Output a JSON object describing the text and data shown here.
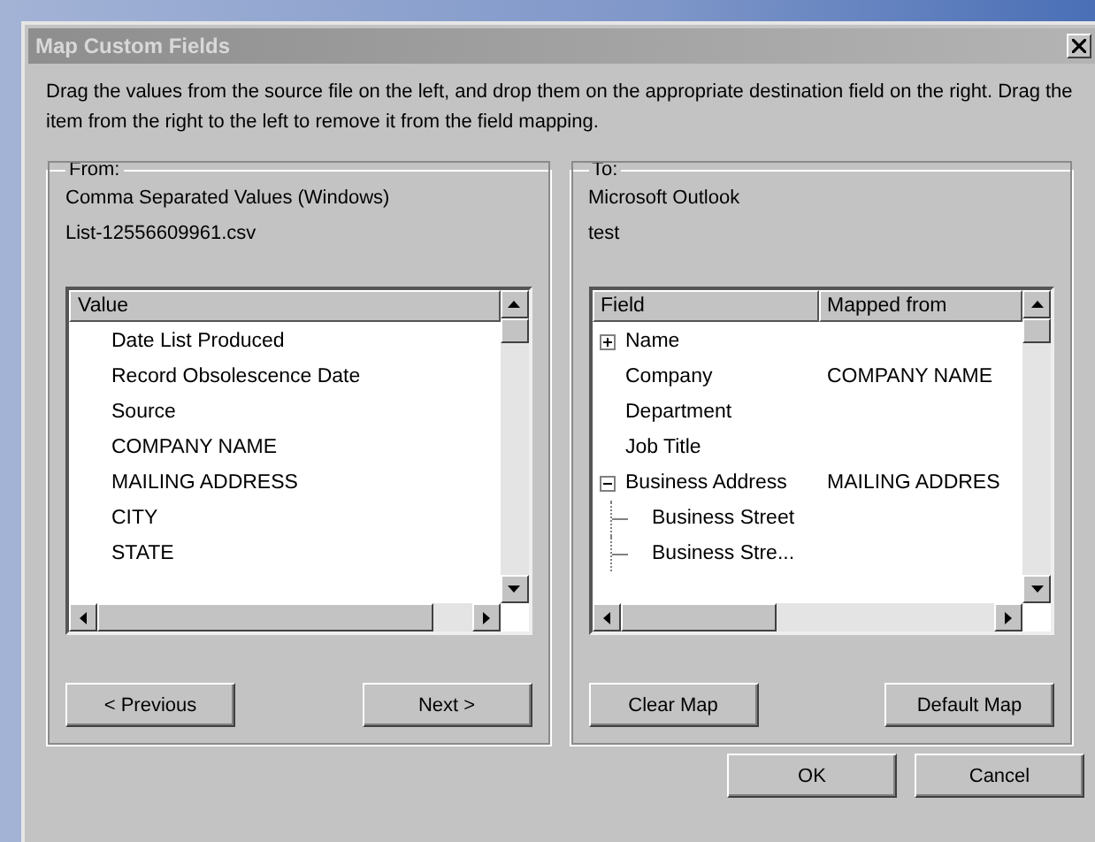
{
  "window": {
    "title": "Map Custom Fields"
  },
  "instructions": "Drag the values from the source file on the left, and drop them on the appropriate destination field on the right.  Drag the item from the right to the left to remove it from the field mapping.",
  "from": {
    "label": "From:",
    "source": "Comma Separated Values (Windows)",
    "file": "List-12556609961.csv",
    "columns": [
      "Value"
    ],
    "values": [
      "Date List Produced",
      "Record Obsolescence Date",
      "Source",
      "COMPANY NAME",
      "MAILING ADDRESS",
      "CITY",
      "STATE"
    ],
    "buttons": [
      "< Previous",
      "Next >"
    ]
  },
  "to": {
    "label": "To:",
    "target": "Microsoft Outlook",
    "folder": "test",
    "columns": [
      "Field",
      "Mapped from"
    ],
    "fields": [
      {
        "name": "Name",
        "expanded": false
      },
      {
        "name": "Company",
        "mapped_from": "COMPANY NAME"
      },
      {
        "name": "Department"
      },
      {
        "name": "Job Title"
      },
      {
        "name": "Business Address",
        "mapped_from": "MAILING ADDRES",
        "expanded": true,
        "children": [
          {
            "name": "Business Street"
          },
          {
            "name": "Business Stre..."
          }
        ]
      }
    ],
    "buttons": [
      "Clear Map",
      "Default Map"
    ]
  },
  "buttons": [
    "OK",
    "Cancel"
  ]
}
